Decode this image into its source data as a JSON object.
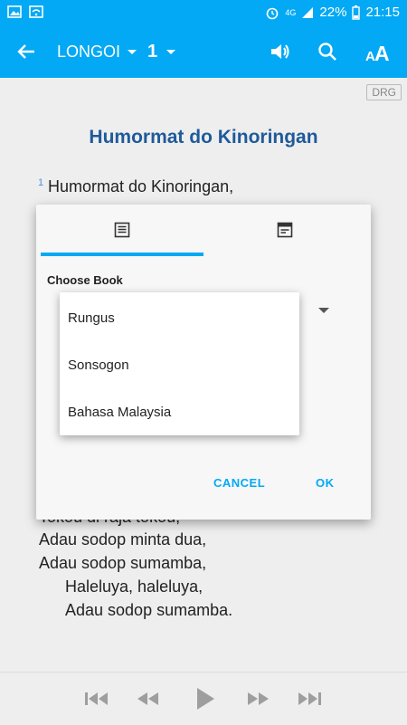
{
  "status": {
    "network": "4G",
    "battery": "22%",
    "time": "21:15"
  },
  "appbar": {
    "book": "LONGOI",
    "chapter": "1"
  },
  "badge": "DRG",
  "song": {
    "title": "Humormat do Kinoringan",
    "verse_number": "1",
    "lines": [
      "Humormat do Kinoringan,",
      "Tokou di raja tokou,",
      "Adau sodop minta dua,",
      "Adau sodop sumamba,",
      "Haleluya, haleluya,",
      "Adau sodop sumamba."
    ]
  },
  "dialog": {
    "choose_book_label": "Choose Book",
    "options": [
      "Rungus",
      "Sonsogon",
      "Bahasa Malaysia"
    ],
    "cancel": "CANCEL",
    "ok": "OK"
  },
  "colors": {
    "accent": "#03a9f4",
    "title": "#1f5a9a"
  }
}
